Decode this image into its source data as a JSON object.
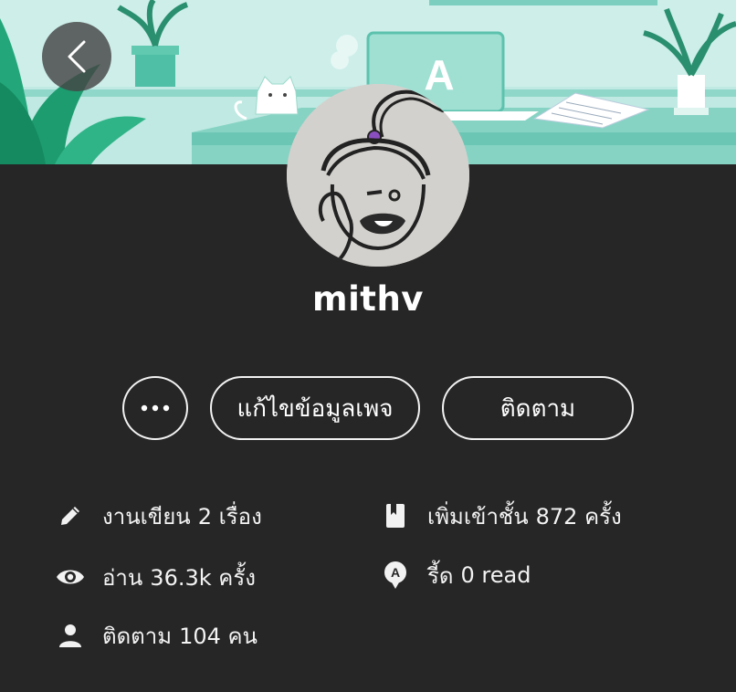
{
  "profile": {
    "username": "mithv",
    "avatar": "avatar-sketch"
  },
  "actions": {
    "more_label": "···",
    "edit_label": "แก้ไขข้อมูลเพจ",
    "follow_label": "ติดตาม"
  },
  "stats": {
    "works": {
      "label": "งานเขียน",
      "value": "2 เรื่อง",
      "icon": "pencil-icon"
    },
    "reads": {
      "label": "อ่าน",
      "value": "36.3k ครั้ง",
      "icon": "eye-icon"
    },
    "followers": {
      "label": "ติดตาม",
      "value": "104 คน",
      "icon": "person-icon"
    },
    "shelf": {
      "label": "เพิ่มเข้าชั้น",
      "value": "872 ครั้ง",
      "icon": "bookmark-icon"
    },
    "coins": {
      "label": "รี้ด",
      "value": "0 read",
      "icon": "read-coin-icon"
    }
  },
  "banner": {
    "laptop_letter": "A"
  },
  "colors": {
    "background": "#262626",
    "banner_bg": "#bfe9e2",
    "accent": "#1bb394"
  }
}
